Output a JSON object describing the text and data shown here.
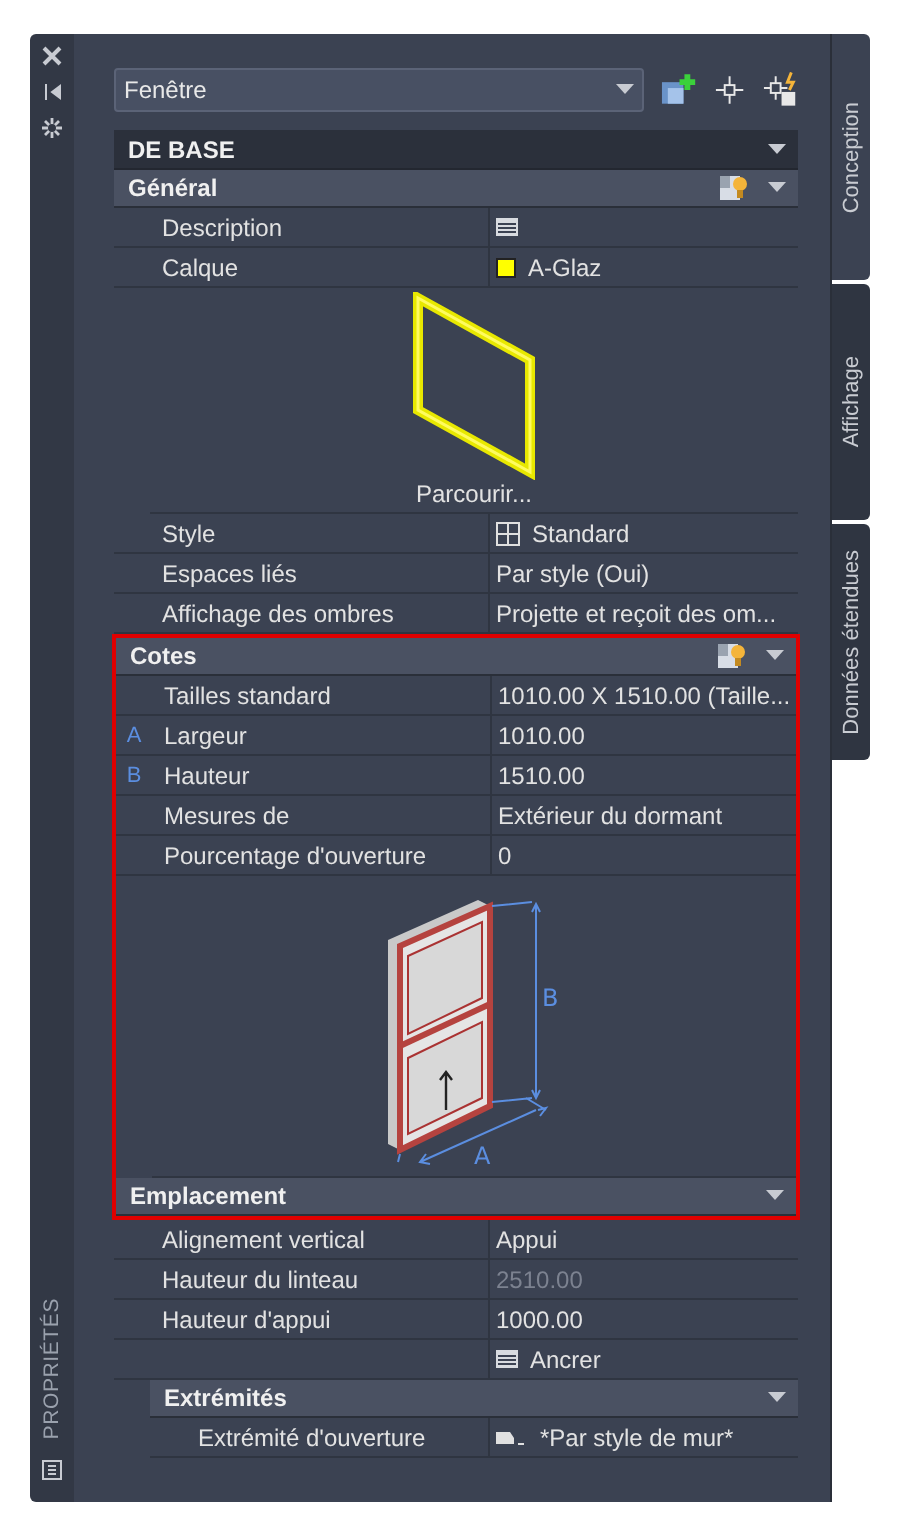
{
  "side_strip": {
    "title": "PROPRIÉTÉS"
  },
  "selector": {
    "value": "Fenêtre"
  },
  "tabs": [
    {
      "label": "Conception",
      "selected": true
    },
    {
      "label": "Affichage",
      "selected": false
    },
    {
      "label": "Données étendues",
      "selected": false
    }
  ],
  "category": {
    "title": "DE BASE",
    "expanded": true,
    "groups": [
      {
        "title": "Général",
        "expanded": true,
        "tool": true,
        "highlighted": false,
        "header_highlighted": false,
        "rows": [
          {
            "kind": "sheet",
            "label": "Description"
          },
          {
            "kind": "swatch",
            "label": "Calque",
            "value": "A-Glaz",
            "color": "#ffff00"
          },
          {
            "kind": "preview",
            "link": "Parcourir..."
          },
          {
            "kind": "grid",
            "label": "Style",
            "value": "Standard"
          },
          {
            "kind": "text",
            "label": "Espaces liés",
            "value": "Par style (Oui)"
          },
          {
            "kind": "text",
            "label": "Affichage des ombres",
            "value": "Projette et reçoit des om..."
          }
        ]
      },
      {
        "title": "Cotes",
        "expanded": true,
        "tool": true,
        "highlighted": true,
        "header_highlighted": true,
        "rows": [
          {
            "kind": "text",
            "label": "Tailles standard",
            "value": "1010.00 X 1510.00 (Taille..."
          },
          {
            "kind": "text",
            "marker": "A",
            "label": "Largeur",
            "value": "1010.00"
          },
          {
            "kind": "text",
            "marker": "B",
            "label": "Hauteur",
            "value": "1510.00"
          },
          {
            "kind": "text",
            "label": "Mesures de",
            "value": "Extérieur du dormant"
          },
          {
            "kind": "text",
            "label": "Pourcentage d'ouverture",
            "value": "0"
          },
          {
            "kind": "diagram",
            "width_label": "A",
            "height_label": "B"
          }
        ]
      },
      {
        "title": "Emplacement",
        "expanded": true,
        "tool": false,
        "highlighted": false,
        "header_highlighted": true,
        "rows": [
          {
            "kind": "text",
            "label": "Alignement vertical",
            "value": "Appui"
          },
          {
            "kind": "text",
            "label": "Hauteur du linteau",
            "value": "2510.00",
            "disabled": true
          },
          {
            "kind": "text",
            "label": "Hauteur d'appui",
            "value": "1000.00"
          },
          {
            "kind": "sheet",
            "value": "Ancrer"
          }
        ],
        "children": [
          {
            "title": "Extrémités",
            "expanded": true,
            "rows": [
              {
                "kind": "endcap",
                "label": "Extrémité d'ouverture",
                "value": "*Par style de mur*"
              }
            ]
          }
        ]
      }
    ]
  }
}
